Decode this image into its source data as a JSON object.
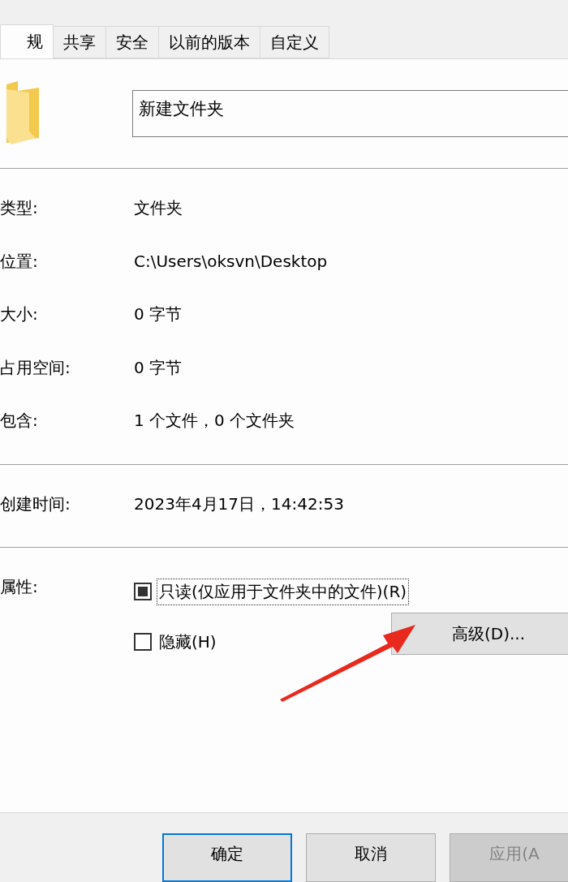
{
  "tabs": [
    {
      "label": "规",
      "selected": true
    },
    {
      "label": "共享",
      "selected": false
    },
    {
      "label": "安全",
      "selected": false
    },
    {
      "label": "以前的版本",
      "selected": false
    },
    {
      "label": "自定义",
      "selected": false
    }
  ],
  "name_field": {
    "value": "新建文件夹"
  },
  "info_groups": [
    [
      {
        "label": "类型:",
        "value": "文件夹"
      },
      {
        "label": "位置:",
        "value": "C:\\Users\\oksvn\\Desktop"
      },
      {
        "label": "大小:",
        "value": "0 字节"
      },
      {
        "label": "占用空间:",
        "value": "0 字节"
      },
      {
        "label": "包含:",
        "value": "1 个文件，0 个文件夹"
      }
    ],
    [
      {
        "label": "创建时间:",
        "value": "2023年4月17日，14:42:53"
      }
    ]
  ],
  "attributes": {
    "label": "属性:",
    "checkboxes": [
      {
        "label": "只读(仅应用于文件夹中的文件)(R)",
        "checked": true,
        "focused": true
      },
      {
        "label": "隐藏(H)",
        "checked": false,
        "focused": false
      }
    ],
    "advanced_button": "高级(D)..."
  },
  "buttons": [
    {
      "label": "确定",
      "default": true,
      "disabled": false
    },
    {
      "label": "取消",
      "default": false,
      "disabled": false
    },
    {
      "label": "应用(A",
      "default": false,
      "disabled": true
    }
  ]
}
